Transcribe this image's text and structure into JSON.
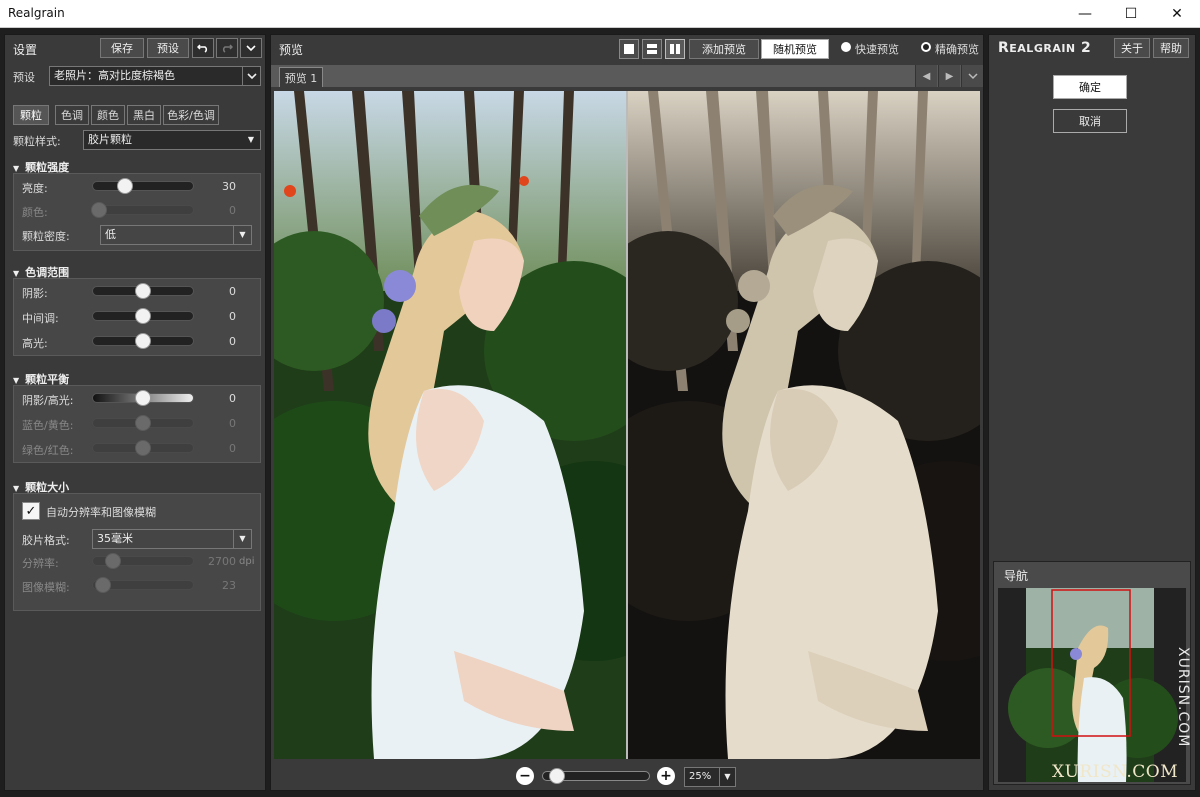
{
  "window": {
    "title": "Realgrain",
    "minimize_glyph": "—",
    "maximize_glyph": "☐",
    "close_glyph": "✕"
  },
  "left_panel": {
    "title": "设置",
    "save_label": "保存",
    "preset_button_label": "预设",
    "preset_label": "预设",
    "preset_value": "老照片：高对比度棕褐色",
    "tabs": [
      "颗粒",
      "色调",
      "颜色",
      "黑白",
      "色彩/色调"
    ],
    "active_tab": "颗粒",
    "grain_style_label": "颗粒样式:",
    "grain_style_value": "胶片颗粒",
    "sections": {
      "intensity": {
        "title": "颗粒强度",
        "brightness_label": "亮度:",
        "brightness_value": "30",
        "color_label": "颜色:",
        "color_value": "0",
        "density_label": "颗粒密度:",
        "density_value": "低"
      },
      "tonal": {
        "title": "色调范围",
        "shadows_label": "阴影:",
        "shadows_value": "0",
        "midtones_label": "中间调:",
        "midtones_value": "0",
        "highlights_label": "高光:",
        "highlights_value": "0"
      },
      "balance": {
        "title": "颗粒平衡",
        "shadow_highlight_label": "阴影/高光:",
        "shadow_highlight_value": "0",
        "blue_yellow_label": "蓝色/黄色:",
        "blue_yellow_value": "0",
        "green_red_label": "绿色/红色:",
        "green_red_value": "0"
      },
      "size": {
        "title": "颗粒大小",
        "auto_label": "自动分辨率和图像模糊",
        "auto_checked": true,
        "film_format_label": "胶片格式:",
        "film_format_value": "35毫米",
        "resolution_label": "分辨率:",
        "resolution_value": "2700",
        "resolution_unit": "dpi",
        "blur_label": "图像模糊:",
        "blur_value": "23"
      }
    }
  },
  "preview": {
    "title": "预览",
    "add_preview_label": "添加预览",
    "random_preview_label": "随机预览",
    "fast_preview_label": "快速预览",
    "accurate_preview_label": "精确预览",
    "selected_mode": "精确预览",
    "tab_label": "预览 1",
    "zoom_value": "25%"
  },
  "right_panel": {
    "logo_big_r": "R",
    "logo_rest": "EALGRAIN",
    "logo_num": "2",
    "about_label": "关于",
    "help_label": "帮助",
    "ok_label": "确定",
    "cancel_label": "取消",
    "navigator_title": "导航"
  },
  "watermark": {
    "vertical": "XURISN.COM",
    "horizontal": "XURISN.COM"
  },
  "colors": {
    "panel_bg": "#3a3a3a",
    "section_bg": "#474747",
    "nav_frame": "#d01010"
  }
}
